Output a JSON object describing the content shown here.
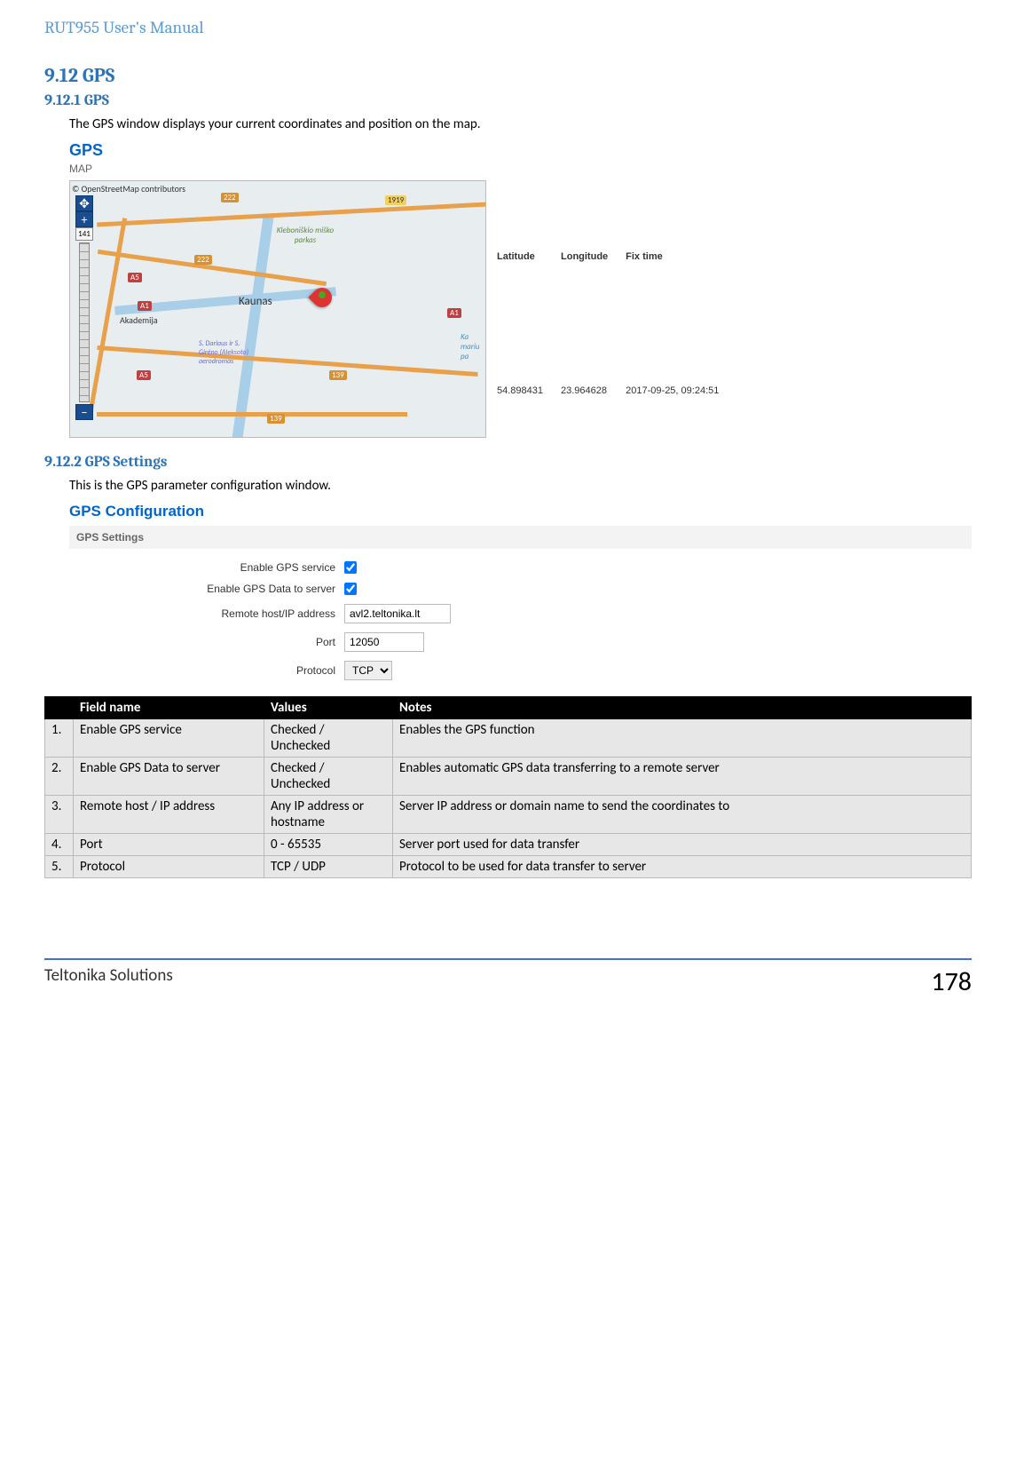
{
  "doc_title": "RUT955 User's Manual",
  "section": {
    "num": "9.12",
    "name": "GPS"
  },
  "sub1": {
    "num": "9.12.1",
    "name": "GPS",
    "intro": "The GPS window displays your current coordinates and position on the map."
  },
  "panel": {
    "title": "GPS",
    "section_label": "MAP",
    "copyright": "© OpenStreetMap contributors",
    "zoom_level": "141",
    "city": "Kaunas",
    "city2": "Akademija",
    "park": "Kleboniškio miško parkas",
    "airport": "S. Dariaus ir S. Girėno (Aleksoto) aerodromas",
    "coast_label": "Ka mariu pa",
    "roads": [
      "A1",
      "A5",
      "222",
      "139",
      "1919"
    ],
    "coord": {
      "hdr_lat": "Latitude",
      "hdr_lon": "Longitude",
      "hdr_fix": "Fix time",
      "lat": "54.898431",
      "lon": "23.964628",
      "fix": "2017-09-25, 09:24:51"
    }
  },
  "sub2": {
    "num": "9.12.2",
    "name": "GPS Settings",
    "intro": "This is the GPS parameter configuration window.",
    "panel_title": "GPS Configuration",
    "section_label": "GPS Settings",
    "fields": {
      "enable_service": "Enable GPS service",
      "enable_data": "Enable GPS Data to server",
      "remote": "Remote host/IP address",
      "remote_value": "avl2.teltonika.lt",
      "port": "Port",
      "port_value": "12050",
      "protocol": "Protocol",
      "protocol_value": "TCP"
    }
  },
  "table": {
    "hdrs": [
      "",
      "Field name",
      "Values",
      "Notes"
    ],
    "rows": [
      [
        "1.",
        "Enable GPS service",
        "Checked / Unchecked",
        "Enables the GPS function"
      ],
      [
        "2.",
        "Enable GPS Data to server",
        "Checked / Unchecked",
        "Enables automatic GPS data transferring to a remote server"
      ],
      [
        "3.",
        "Remote host / IP address",
        "Any IP address or hostname",
        "Server IP address or domain name to send the coordinates to"
      ],
      [
        "4.",
        "Port",
        "0 - 65535",
        "Server port used for data transfer"
      ],
      [
        "5.",
        "Protocol",
        "TCP / UDP",
        "Protocol to be used for data transfer to server"
      ]
    ]
  },
  "footer": {
    "company": "Teltonika Solutions",
    "page": "178"
  }
}
